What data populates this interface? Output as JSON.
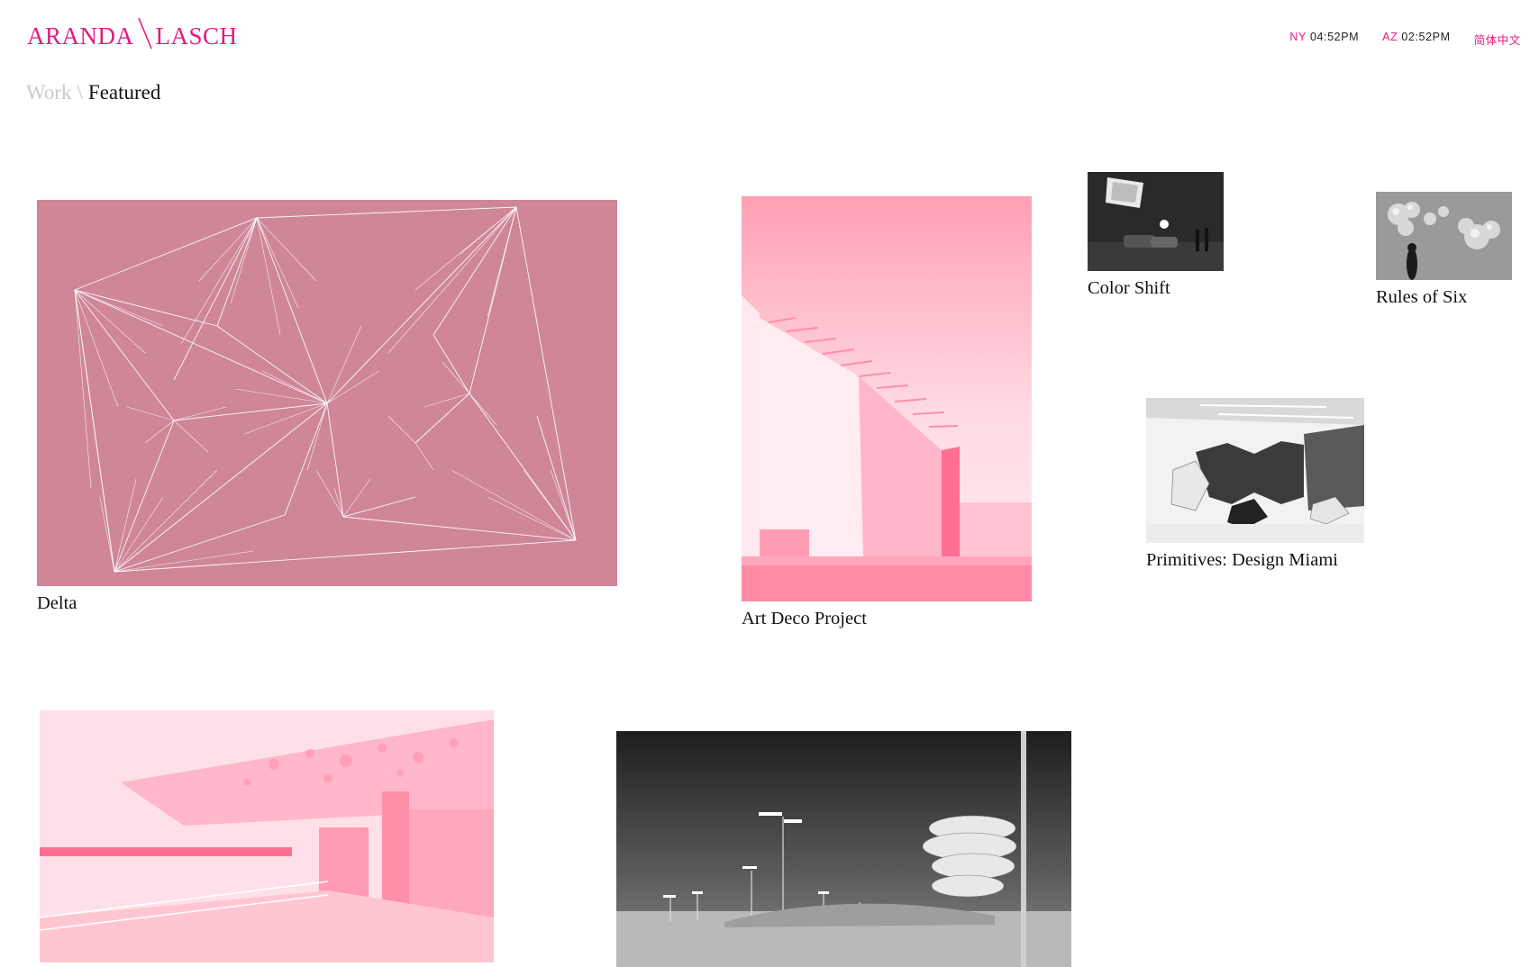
{
  "brand": {
    "left": "ARANDA",
    "right": "LASCH",
    "color": "#e6197e"
  },
  "clocks": [
    {
      "code": "NY",
      "time": "04:52PM"
    },
    {
      "code": "AZ",
      "time": "02:52PM"
    }
  ],
  "language_link": "简体中文",
  "breadcrumb": {
    "section": "Work",
    "separator": "\\",
    "current": "Featured"
  },
  "projects": [
    {
      "title": "Delta"
    },
    {
      "title": "Art Deco Project"
    },
    {
      "title": "Color Shift"
    },
    {
      "title": "Rules of Six"
    },
    {
      "title": "Primitives: Design Miami"
    },
    {
      "title": ""
    },
    {
      "title": ""
    }
  ],
  "colors": {
    "accent": "#e6197e",
    "delta_bg": "#cf8697",
    "pink_light": "#ffc6d2",
    "pink_mid": "#ff8fa8"
  }
}
